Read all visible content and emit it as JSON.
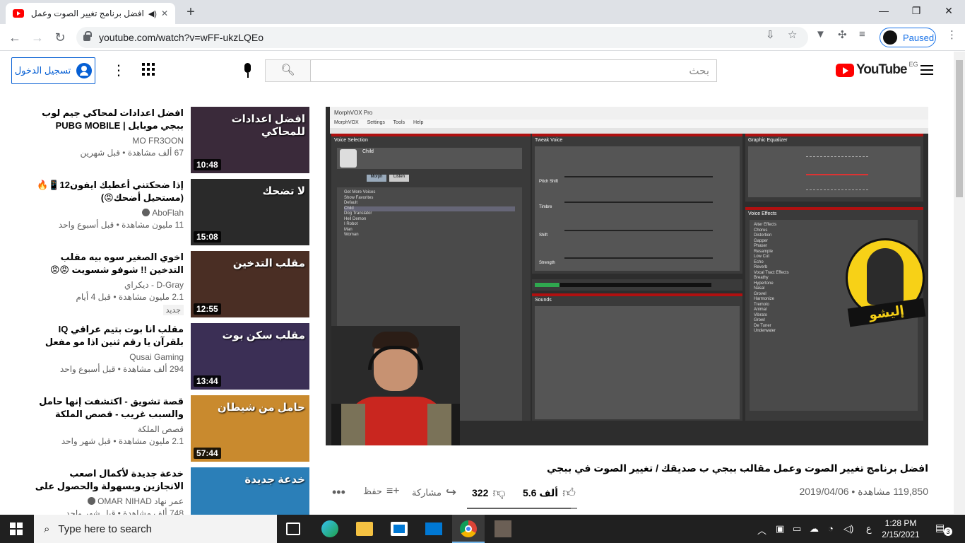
{
  "browser": {
    "tab_title": "افضل برنامج تغيير الصوت وعمل",
    "new_tab": "+",
    "url": "youtube.com/watch?v=wFF-ukzLQEo",
    "profile_status": "Paused",
    "window_controls": [
      "—",
      "❐",
      "✕"
    ]
  },
  "masthead": {
    "signin_label": "تسجيل الدخول",
    "search_placeholder": "بحث",
    "logo_text": "YouTube",
    "logo_region": "EG"
  },
  "recommendations": [
    {
      "title": "افضل اعدادات لمحاكي جيم لوب ببجي موبايل | PUBG MOBILE",
      "channel": "MO FR3OON",
      "stats": "67 ألف مشاهدة • قبل شهرين",
      "duration": "10:48",
      "verified": false,
      "thumb_color": "#3a2a3a",
      "thumb_text": "افضل اعدادات للمحاكي"
    },
    {
      "title": "إذا ضحكتني أعطيك ايفون12📱🔥(مستحيل أضحك😡)",
      "channel": "AboFlah",
      "stats": "11 مليون مشاهدة • قبل أسبوع واحد",
      "duration": "15:08",
      "verified": true,
      "thumb_color": "#2a2a2a",
      "thumb_text": "لا تضحك"
    },
    {
      "title": "اخوي الصغير سوه بيه مقلب التدخين !! شوفو شسويت 😡😡",
      "channel": "D-Gray - ديكراي",
      "stats": "2.1 مليون مشاهدة • قبل 4 أيام",
      "duration": "12:55",
      "verified": false,
      "badge": "جديد",
      "thumb_color": "#4a2e24",
      "thumb_text": "مقلب التدخين"
    },
    {
      "title": "مقلب انا بوت بتيم عراقي IQ بلقرآن يا رقم ثنين اذا مو مفعل هكر انا مو ريال 😂ببجي...",
      "channel": "Qusai Gaming",
      "stats": "294 ألف مشاهدة • قبل أسبوع واحد",
      "duration": "13:44",
      "verified": false,
      "thumb_color": "#3b2f55",
      "thumb_text": "مقلب سكن بوت"
    },
    {
      "title": "قصة تشويق - اكتشفت إنها حامل والسبب غريب - قصص الملكة",
      "channel": "قصص الملكة",
      "stats": "2.1 مليون مشاهدة • قبل شهر واحد",
      "duration": "57:44",
      "verified": false,
      "thumb_color": "#c98a2e",
      "thumb_text": "حامل من شيطان"
    },
    {
      "title": "خدعة جديدة لأكمال اصعب الانجازين وبسهولة والحصول على مكافأة نقاط انجاز وصناديق...",
      "channel": "عمر نهاد OMAR NIHAD",
      "stats": "748 ألف مشاهدة • قبل شهر واحد",
      "duration": "",
      "verified": true,
      "thumb_color": "#2b7fb8",
      "thumb_text": "خدعة جديدة"
    }
  ],
  "player": {
    "app_title": "MorphVOX Pro",
    "panels": [
      "Voice Selection",
      "Tweak Voice",
      "Graphic Equalizer",
      "Voice Effects",
      "Sounds"
    ],
    "voice_name": "Child",
    "voices": [
      "Get More Voices",
      "Show Favorites",
      "Default",
      "Child",
      "Dog Translator",
      "Hell Demon",
      "I Robot",
      "Man",
      "Woman"
    ],
    "effects": [
      "Alter Effects",
      "Chorus",
      "Distortion",
      "Gapper",
      "Phaser",
      "Resample",
      "Low Cut",
      "Echo",
      "Reverb",
      "Vocal Tract Effects",
      "Breathy",
      "Hypertone",
      "Nasal",
      "Grovel",
      "Harmonize",
      "Tremolo",
      "Animal",
      "Vibrato",
      "Growl",
      "De Tuner",
      "Underwater"
    ],
    "sliders": [
      "Pitch Shift",
      "Timbre",
      "Shift",
      "Strength"
    ],
    "logo_text": "إليشو"
  },
  "video": {
    "title": "افضل برنامج تغيير الصوت وعمل مقالب ببجي ب صديقك / تغيير الصوت في ببجي",
    "views": "119,850 مشاهدة • 2019/04/06",
    "likes": "5.6 ألف",
    "dislikes": "322",
    "share": "مشاركة",
    "save": "حفظ",
    "like_ratio": 0.945
  },
  "taskbar": {
    "search_placeholder": "Type here to search",
    "time": "1:28 PM",
    "date": "2/15/2021",
    "lang": "ع",
    "notifications": "3"
  }
}
